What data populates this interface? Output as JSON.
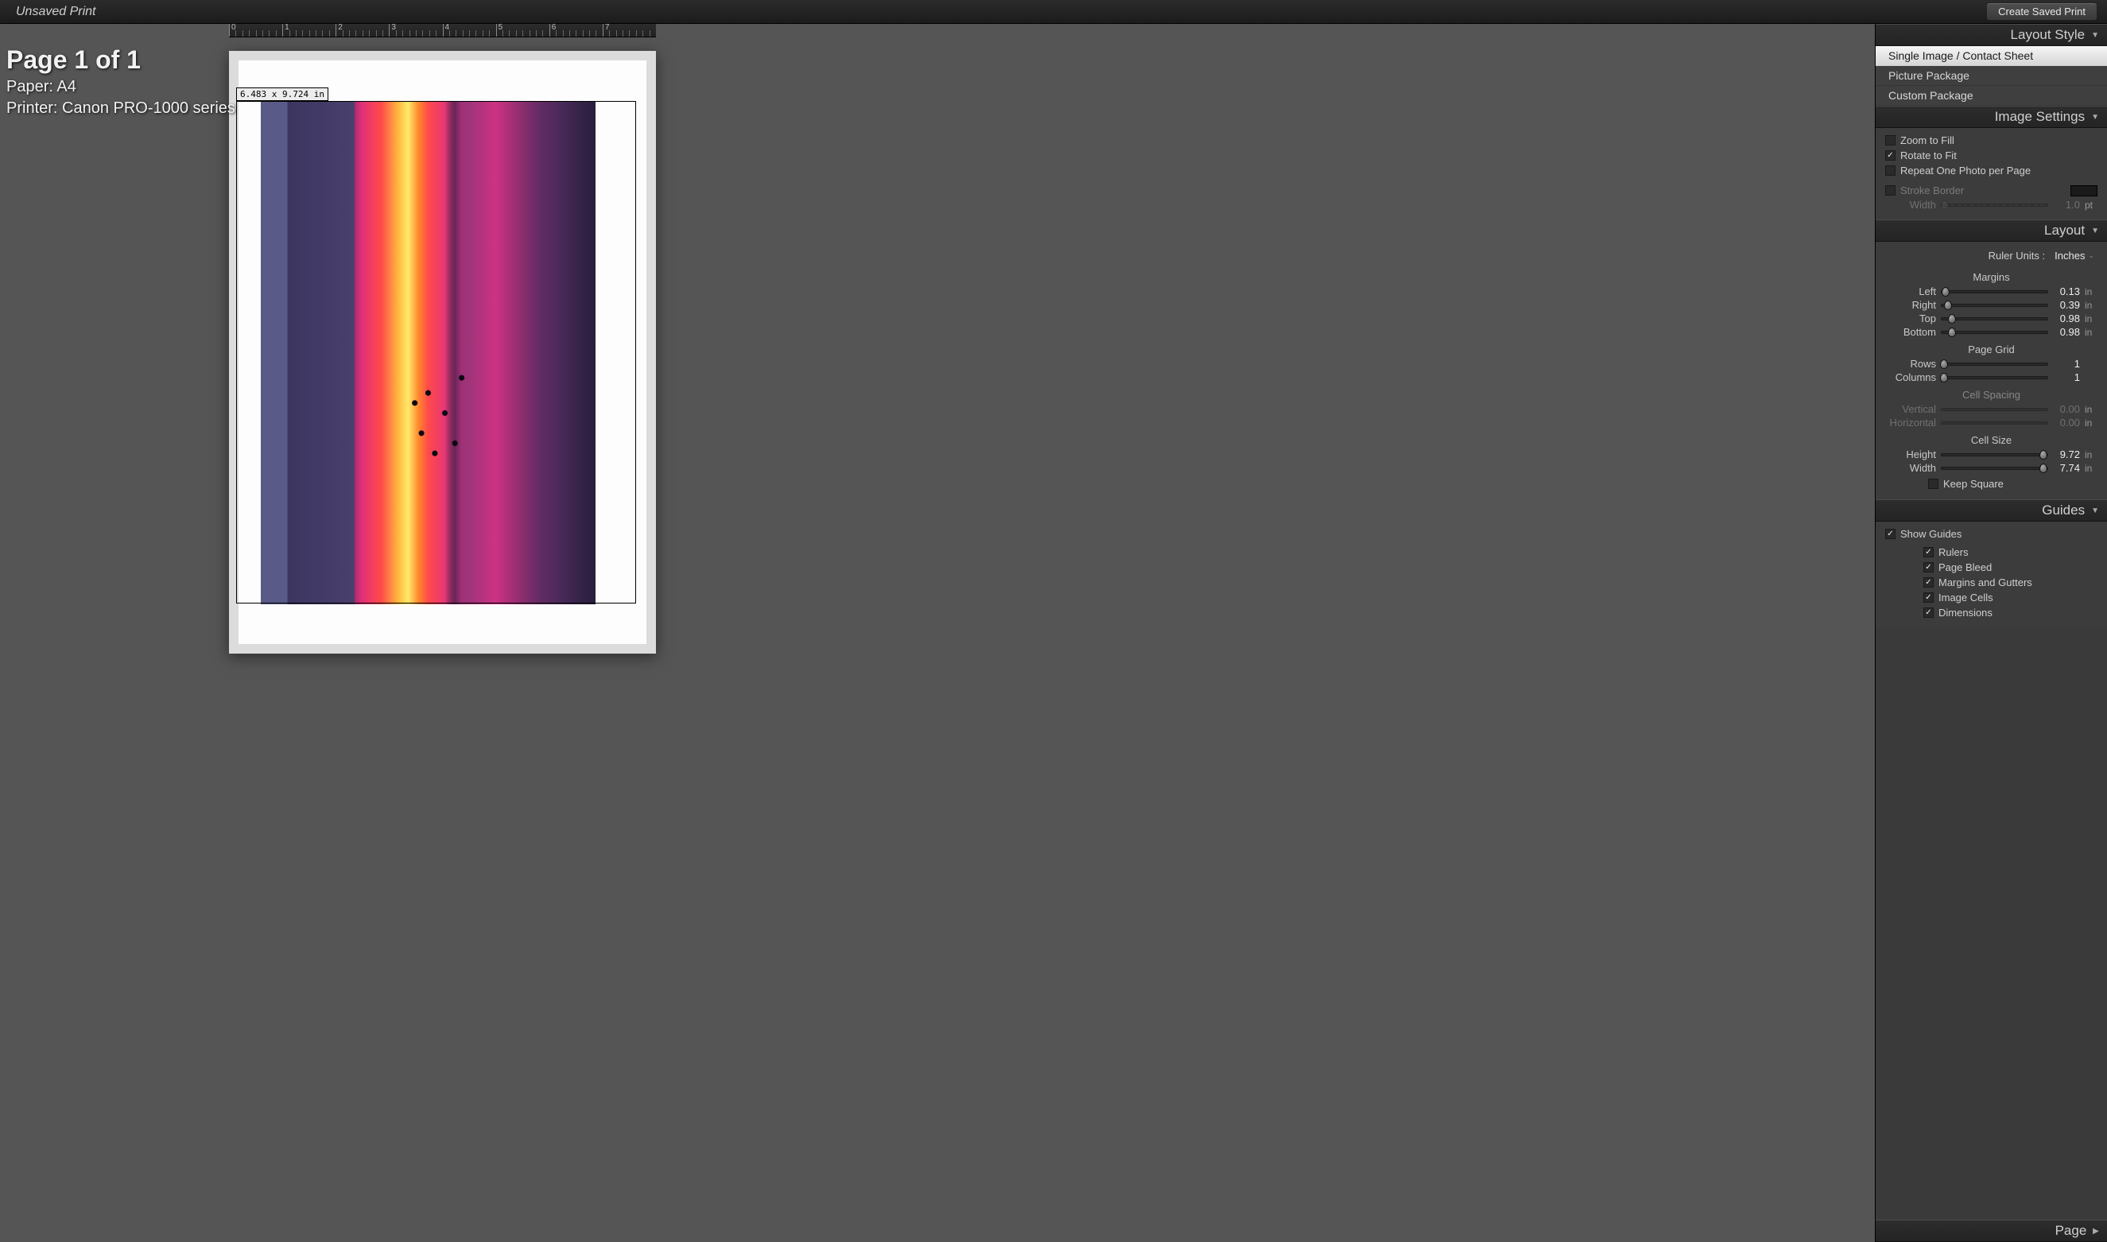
{
  "topbar": {
    "title": "Unsaved Print",
    "create_saved_label": "Create Saved Print"
  },
  "overlay": {
    "page_heading": "Page 1 of 1",
    "paper_line": "Paper:  A4",
    "printer_line": "Printer:  Canon PRO-1000 series"
  },
  "canvas": {
    "dim_label": "6.483 x 9.724 in",
    "ruler_max": 8
  },
  "panels": {
    "layout_style": {
      "title": "Layout Style",
      "items": [
        {
          "label": "Single Image / Contact Sheet",
          "selected": true
        },
        {
          "label": "Picture Package",
          "selected": false
        },
        {
          "label": "Custom Package",
          "selected": false
        }
      ]
    },
    "image_settings": {
      "title": "Image Settings",
      "zoom_to_fill": {
        "label": "Zoom to Fill",
        "checked": false
      },
      "rotate_to_fit": {
        "label": "Rotate to Fit",
        "checked": true
      },
      "repeat_one": {
        "label": "Repeat One Photo per Page",
        "checked": false
      },
      "stroke_border": {
        "label": "Stroke Border",
        "checked": false
      },
      "stroke_width": {
        "label": "Width",
        "value": "1.0",
        "unit": "pt"
      }
    },
    "layout": {
      "title": "Layout",
      "ruler_units": {
        "label": "Ruler Units :",
        "value": "Inches"
      },
      "margins_title": "Margins",
      "margins": {
        "left": {
          "label": "Left",
          "value": "0.13",
          "unit": "in",
          "pos": 4
        },
        "right": {
          "label": "Right",
          "value": "0.39",
          "unit": "in",
          "pos": 6
        },
        "top": {
          "label": "Top",
          "value": "0.98",
          "unit": "in",
          "pos": 10
        },
        "bottom": {
          "label": "Bottom",
          "value": "0.98",
          "unit": "in",
          "pos": 10
        }
      },
      "grid_title": "Page Grid",
      "grid": {
        "rows": {
          "label": "Rows",
          "value": "1",
          "pos": 2
        },
        "columns": {
          "label": "Columns",
          "value": "1",
          "pos": 2
        }
      },
      "cellspacing_title": "Cell Spacing",
      "cellspacing": {
        "vertical": {
          "label": "Vertical",
          "value": "0.00",
          "unit": "in"
        },
        "horizontal": {
          "label": "Horizontal",
          "value": "0.00",
          "unit": "in"
        }
      },
      "cellsize_title": "Cell Size",
      "cellsize": {
        "height": {
          "label": "Height",
          "value": "9.72",
          "unit": "in",
          "pos": 96
        },
        "width": {
          "label": "Width",
          "value": "7.74",
          "unit": "in",
          "pos": 96
        }
      },
      "keep_square": {
        "label": "Keep Square",
        "checked": false
      }
    },
    "guides": {
      "title": "Guides",
      "show_guides": {
        "label": "Show Guides",
        "checked": true
      },
      "items": [
        {
          "key": "rulers",
          "label": "Rulers",
          "checked": true
        },
        {
          "key": "bleed",
          "label": "Page Bleed",
          "checked": true
        },
        {
          "key": "margins",
          "label": "Margins and Gutters",
          "checked": true
        },
        {
          "key": "cells",
          "label": "Image Cells",
          "checked": true
        },
        {
          "key": "dims",
          "label": "Dimensions",
          "checked": true
        }
      ]
    },
    "page": {
      "title": "Page"
    }
  }
}
